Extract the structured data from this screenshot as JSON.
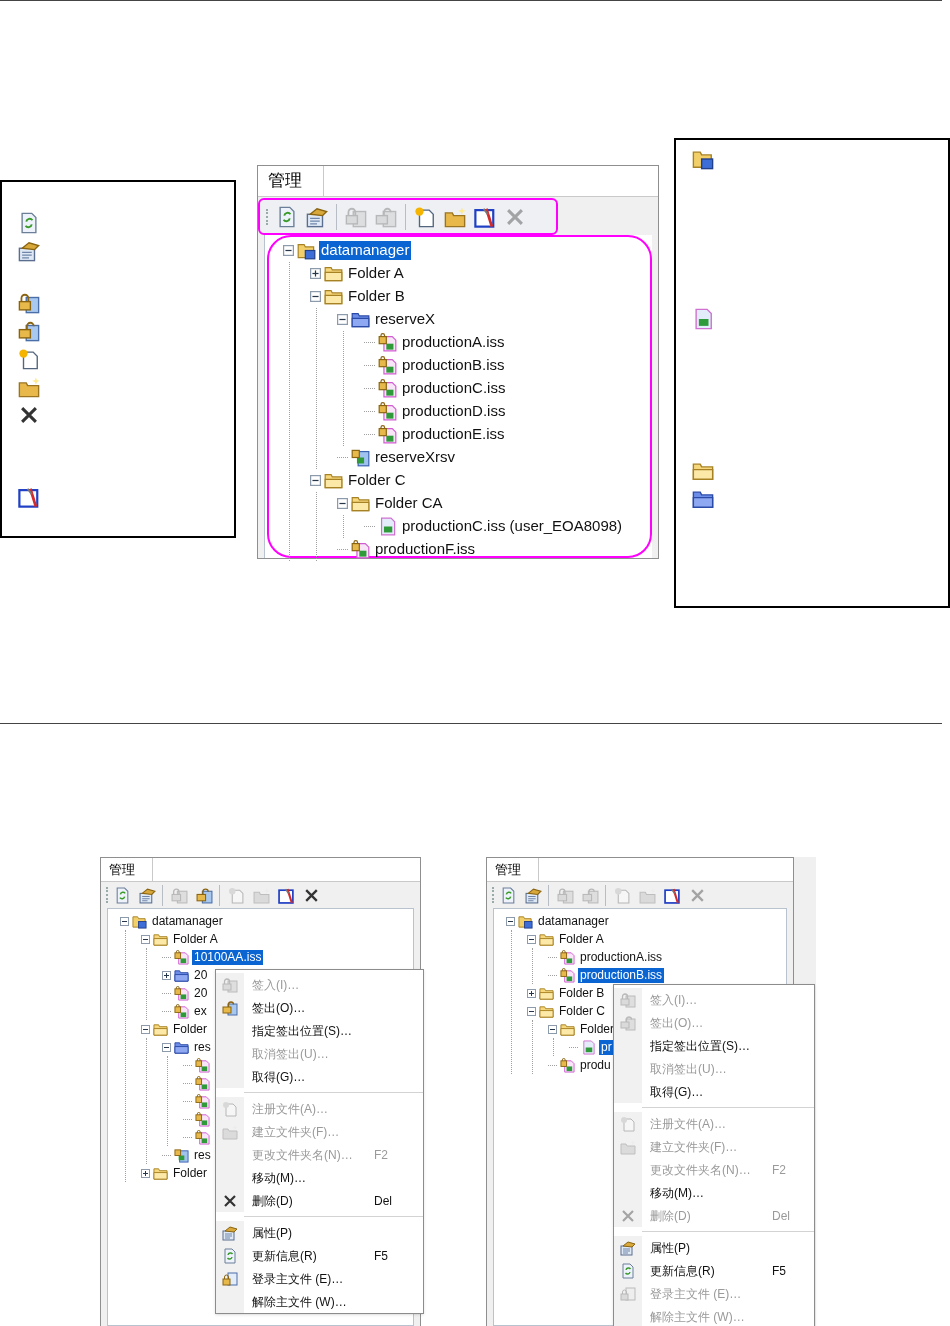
{
  "top_panel": {
    "tab": {
      "label": "管理",
      "selected": true
    },
    "toolbar": [
      [
        {
          "kind": "refresh",
          "disabled": false
        },
        {
          "kind": "props",
          "disabled": false
        }
      ],
      [
        {
          "kind": "checkin",
          "disabled": true
        },
        {
          "kind": "checkout",
          "disabled": true
        }
      ],
      [
        {
          "kind": "newfile",
          "disabled": false
        },
        {
          "kind": "newfolder",
          "disabled": false
        },
        {
          "kind": "tool",
          "disabled": false
        },
        {
          "kind": "delete",
          "disabled": true
        }
      ]
    ],
    "tree": [
      {
        "kind": "root",
        "label": "datamanager",
        "selected": true,
        "expanded": true,
        "children": [
          {
            "kind": "folder",
            "label": "Folder A",
            "selected": false,
            "expanded": false
          },
          {
            "kind": "folder",
            "label": "Folder B",
            "selected": false,
            "expanded": true,
            "children": [
              {
                "kind": "bluefolder",
                "label": "reserveX",
                "selected": false,
                "expanded": true,
                "children": [
                  {
                    "kind": "lockedfile",
                    "label": "productionA.iss",
                    "selected": false
                  },
                  {
                    "kind": "lockedfile",
                    "label": "productionB.iss",
                    "selected": false
                  },
                  {
                    "kind": "lockedfile",
                    "label": "productionC.iss",
                    "selected": false
                  },
                  {
                    "kind": "lockedfile",
                    "label": "productionD.iss",
                    "selected": false
                  },
                  {
                    "kind": "lockedfile",
                    "label": "productionE.iss",
                    "selected": false
                  }
                ]
              },
              {
                "kind": "reserve",
                "label": "reserveXrsv",
                "selected": false
              }
            ]
          },
          {
            "kind": "folder",
            "label": "Folder C",
            "selected": false,
            "expanded": true,
            "children": [
              {
                "kind": "folder",
                "label": "Folder CA",
                "selected": false,
                "expanded": true,
                "children": [
                  {
                    "kind": "file",
                    "label": "productionC.iss (user_EOA8098)",
                    "selected": false
                  }
                ]
              },
              {
                "kind": "lockedfile",
                "label": "productionF.iss",
                "selected": false
              }
            ]
          }
        ]
      }
    ]
  },
  "bottom_left_panel": {
    "tab": {
      "label": "管理",
      "selected": true
    },
    "toolbar": [
      [
        {
          "kind": "refresh",
          "disabled": false
        },
        {
          "kind": "props",
          "disabled": false
        }
      ],
      [
        {
          "kind": "checkin",
          "disabled": true
        },
        {
          "kind": "checkout",
          "disabled": false
        }
      ],
      [
        {
          "kind": "newfile",
          "disabled": true
        },
        {
          "kind": "newfolder",
          "disabled": true
        },
        {
          "kind": "tool",
          "disabled": false
        },
        {
          "kind": "delete",
          "disabled": false
        }
      ]
    ],
    "tree": [
      {
        "kind": "root",
        "label": "datamanager",
        "selected": false,
        "expanded": true,
        "children": [
          {
            "kind": "folder",
            "label": "Folder A",
            "selected": false,
            "expanded": true,
            "children": [
              {
                "kind": "lockedfile",
                "label": "10100AA.iss",
                "selected": true
              },
              {
                "kind": "bluefolder",
                "label": "20",
                "selected": false,
                "expanded": false
              },
              {
                "kind": "lockedfile",
                "label": "20",
                "selected": false
              },
              {
                "kind": "lockedfile",
                "label": "ex",
                "selected": false
              }
            ]
          },
          {
            "kind": "folder",
            "label": "Folder",
            "selected": false,
            "expanded": true,
            "children": [
              {
                "kind": "bluefolder",
                "label": "res",
                "selected": false,
                "expanded": true,
                "children": [
                  {
                    "kind": "lockedfile"
                  },
                  {
                    "kind": "lockedfile"
                  },
                  {
                    "kind": "lockedfile"
                  },
                  {
                    "kind": "lockedfile"
                  },
                  {
                    "kind": "lockedfile"
                  }
                ]
              },
              {
                "kind": "reserve",
                "label": "res",
                "selected": false
              }
            ]
          },
          {
            "kind": "folder",
            "label": "Folder",
            "selected": false,
            "expanded": false
          }
        ]
      }
    ],
    "context_menu": [
      [
        {
          "kind": "checkin",
          "label": "签入(I)…",
          "disabled": true
        },
        {
          "kind": "checkout",
          "label": "签出(O)…",
          "disabled": false
        },
        {
          "label": "指定签出位置(S)…",
          "disabled": false
        },
        {
          "label": "取消签出(U)…",
          "disabled": true
        },
        {
          "label": "取得(G)…",
          "disabled": false
        }
      ],
      [
        {
          "kind": "newfile",
          "label": "注册文件(A)…",
          "disabled": true
        },
        {
          "kind": "newfolder",
          "label": "建立文件夹(F)…",
          "disabled": true
        },
        {
          "label": "更改文件夹名(N)…",
          "shortcut": "F2",
          "disabled": true
        },
        {
          "label": "移动(M)…",
          "disabled": false
        },
        {
          "kind": "delete",
          "label": "删除(D)",
          "shortcut": "Del",
          "disabled": false
        }
      ],
      [
        {
          "kind": "props",
          "label": "属性(P)",
          "disabled": false
        },
        {
          "kind": "refresh",
          "label": "更新信息(R)",
          "shortcut": "F5",
          "disabled": false
        },
        {
          "kind": "regmaster",
          "label": "登录主文件 (E)…",
          "disabled": false
        },
        {
          "label": "解除主文件 (W)…",
          "disabled": false
        }
      ]
    ]
  },
  "bottom_right_panel": {
    "tab": {
      "label": "管理",
      "selected": true
    },
    "toolbar": [
      [
        {
          "kind": "refresh",
          "disabled": false
        },
        {
          "kind": "props",
          "disabled": false
        }
      ],
      [
        {
          "kind": "checkin",
          "disabled": true
        },
        {
          "kind": "checkout",
          "disabled": true
        }
      ],
      [
        {
          "kind": "newfile",
          "disabled": true
        },
        {
          "kind": "newfolder",
          "disabled": true
        },
        {
          "kind": "tool",
          "disabled": false
        },
        {
          "kind": "delete",
          "disabled": true
        }
      ]
    ],
    "tree": [
      {
        "kind": "root",
        "label": "datamanager",
        "selected": false,
        "expanded": true,
        "children": [
          {
            "kind": "folder",
            "label": "Folder A",
            "selected": false,
            "expanded": true,
            "children": [
              {
                "kind": "lockedfile",
                "label": "productionA.iss",
                "selected": false
              },
              {
                "kind": "lockedfile",
                "label": "productionB.iss",
                "selected": true
              }
            ]
          },
          {
            "kind": "folder",
            "label": "Folder B",
            "selected": false,
            "expanded": false
          },
          {
            "kind": "folder",
            "label": "Folder C",
            "selected": false,
            "expanded": true,
            "children": [
              {
                "kind": "folder",
                "label": "Folder",
                "selected": false,
                "expanded": true,
                "children": [
                  {
                    "kind": "file",
                    "label": "pr",
                    "selected": true
                  }
                ]
              },
              {
                "kind": "lockedfile",
                "label": "produ",
                "selected": false
              }
            ]
          }
        ]
      }
    ],
    "context_menu": [
      [
        {
          "kind": "checkin",
          "label": "签入(I)…",
          "disabled": true
        },
        {
          "kind": "checkout",
          "label": "签出(O)…",
          "disabled": true
        },
        {
          "label": "指定签出位置(S)…",
          "disabled": false
        },
        {
          "label": "取消签出(U)…",
          "disabled": true
        },
        {
          "label": "取得(G)…",
          "disabled": false
        }
      ],
      [
        {
          "kind": "newfile",
          "label": "注册文件(A)…",
          "disabled": true
        },
        {
          "kind": "newfolder",
          "label": "建立文件夹(F)…",
          "disabled": true
        },
        {
          "label": "更改文件夹名(N)…",
          "shortcut": "F2",
          "disabled": true
        },
        {
          "label": "移动(M)…",
          "disabled": false
        },
        {
          "kind": "delete",
          "label": "删除(D)",
          "shortcut": "Del",
          "disabled": true
        }
      ],
      [
        {
          "kind": "props",
          "label": "属性(P)",
          "disabled": false
        },
        {
          "kind": "refresh",
          "label": "更新信息(R)",
          "shortcut": "F5",
          "disabled": false
        },
        {
          "kind": "regmaster",
          "label": "登录主文件 (E)…",
          "disabled": true
        },
        {
          "label": "解除主文件 (W)…",
          "disabled": true
        }
      ]
    ]
  }
}
